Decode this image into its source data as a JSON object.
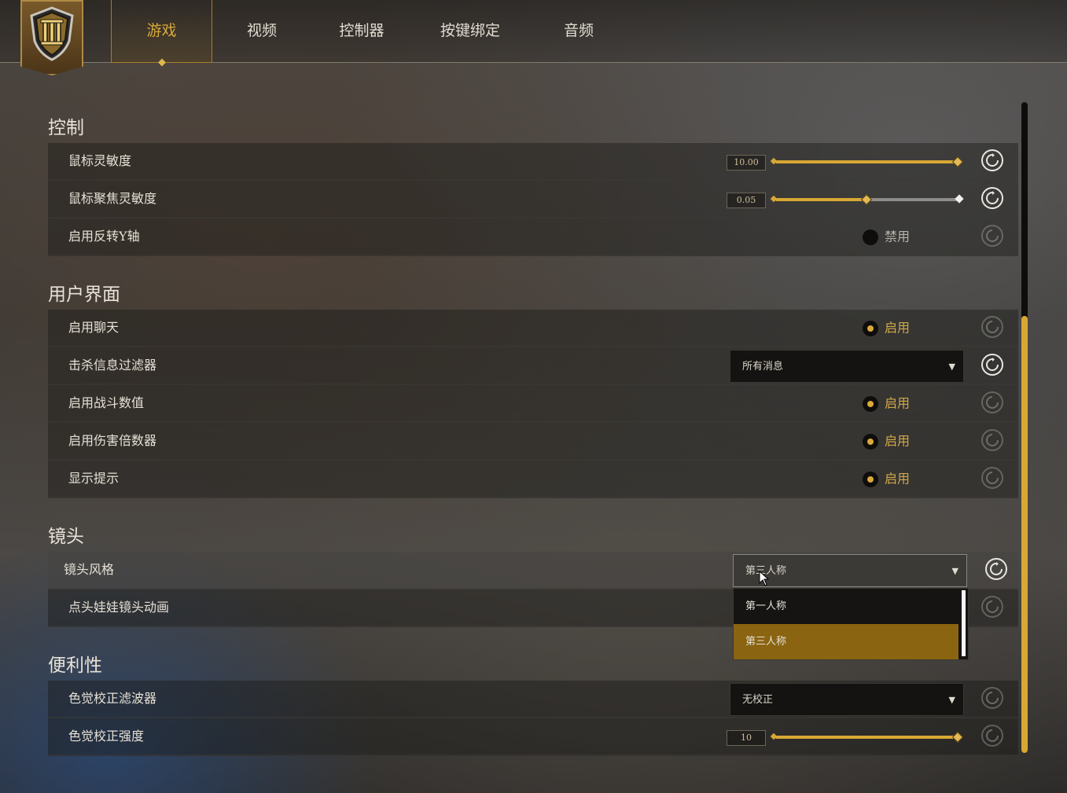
{
  "nav": {
    "tabs": [
      {
        "label": "游戏",
        "active": true
      },
      {
        "label": "视频",
        "active": false
      },
      {
        "label": "控制器",
        "active": false
      },
      {
        "label": "按键绑定",
        "active": false
      },
      {
        "label": "音频",
        "active": false
      }
    ],
    "logo_icon": "shield-emblem-icon"
  },
  "sections": {
    "control": {
      "title": "控制",
      "mouse_sensitivity": {
        "label": "鼠标灵敏度",
        "value": "10.00",
        "fraction": 1.0
      },
      "mouse_focus_sensitivity": {
        "label": "鼠标聚焦灵敏度",
        "value": "0.05",
        "fraction": 0.5
      },
      "invert_y": {
        "label": "启用反转Y轴",
        "state": "禁用",
        "on": false
      }
    },
    "ui": {
      "title": "用户界面",
      "chat": {
        "label": "启用聊天",
        "state": "启用",
        "on": true
      },
      "kill_filter": {
        "label": "击杀信息过滤器",
        "selected": "所有消息"
      },
      "combat_numbers": {
        "label": "启用战斗数值",
        "state": "启用",
        "on": true
      },
      "damage_multiplier": {
        "label": "启用伤害倍数器",
        "state": "启用",
        "on": true
      },
      "show_hints": {
        "label": "显示提示",
        "state": "启用",
        "on": true
      }
    },
    "camera": {
      "title": "镜头",
      "camera_style": {
        "label": "镜头风格",
        "selected": "第三人称",
        "options": [
          "第一人称",
          "第三人称"
        ]
      },
      "bobblehead": {
        "label": "点头娃娃镜头动画"
      }
    },
    "convenience": {
      "title": "便利性",
      "colorblind_filter": {
        "label": "色觉校正滤波器",
        "selected": "无校正"
      },
      "colorblind_strength": {
        "label": "色觉校正强度",
        "value": "10",
        "fraction": 1.0
      }
    }
  },
  "icons": {
    "reset": "reset-icon",
    "dropdown_arrow": "▼"
  },
  "colors": {
    "accent": "#d8a833",
    "selected_option": "#8a6410"
  }
}
